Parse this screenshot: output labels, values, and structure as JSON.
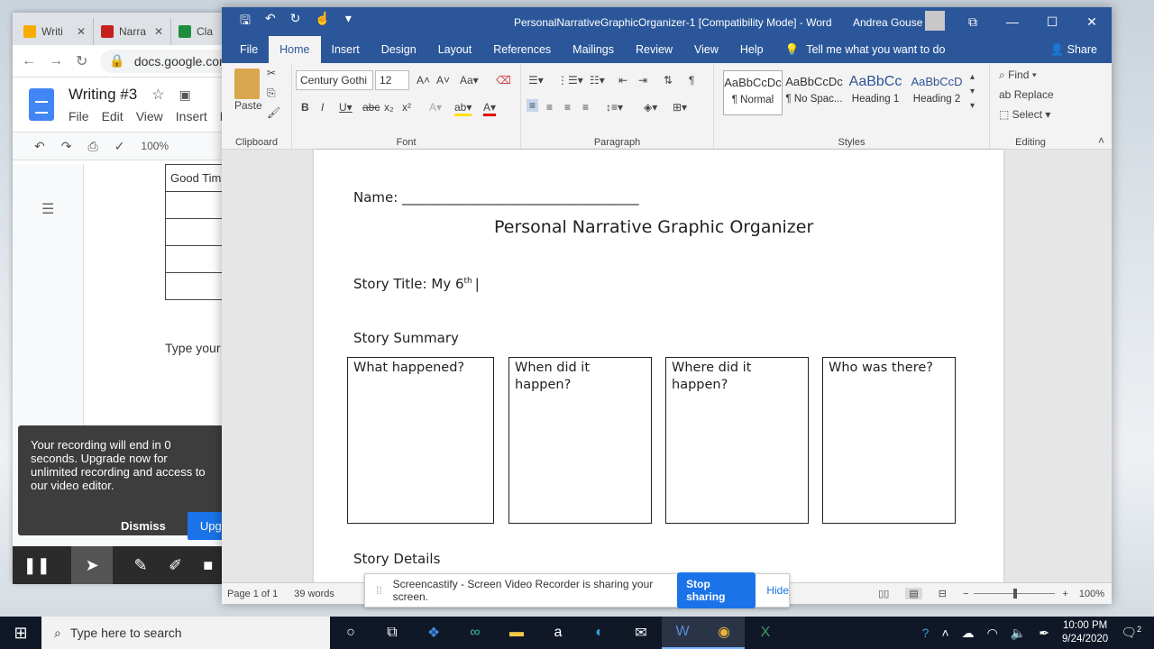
{
  "chrome": {
    "tabs": [
      {
        "label": "Writi",
        "color": "#f9ab00"
      },
      {
        "label": "Narra",
        "color": "#c5221f"
      },
      {
        "label": "Cla",
        "color": "#1e8e3e"
      }
    ],
    "url": "docs.google.com",
    "doc_title": "Writing #3",
    "menu": [
      "File",
      "Edit",
      "View",
      "Insert",
      "F"
    ],
    "zoom": "100%",
    "table_first_cell": "Good Tim",
    "body_text": "Type your"
  },
  "recording": {
    "message": "Your recording will end in 0 seconds. Upgrade now for unlimited recording and access to our video editor.",
    "dismiss": "Dismiss",
    "upgrade": "Upgr"
  },
  "word": {
    "title": "PersonalNarrativeGraphicOrganizer-1  [Compatibility Mode]  -  Word",
    "user": "Andrea Gouse",
    "tabs": [
      "File",
      "Home",
      "Insert",
      "Design",
      "Layout",
      "References",
      "Mailings",
      "Review",
      "View",
      "Help"
    ],
    "active_tab": "Home",
    "tell_me": "Tell me what you want to do",
    "share": "Share",
    "ribbon": {
      "paste": "Paste",
      "font_name": "Century Gothi",
      "font_size": "12",
      "styles": [
        {
          "preview": "AaBbCcDc",
          "name": "¶ Normal"
        },
        {
          "preview": "AaBbCcDc",
          "name": "¶ No Spac..."
        },
        {
          "preview": "AaBbCс",
          "name": "Heading 1"
        },
        {
          "preview": "AaBbCcD",
          "name": "Heading 2"
        }
      ],
      "find": "Find",
      "replace": "Replace",
      "select": "Select",
      "groups": {
        "clipboard": "Clipboard",
        "font": "Font",
        "paragraph": "Paragraph",
        "styles": "Styles",
        "editing": "Editing"
      }
    },
    "document": {
      "name_label": "Name: ___________________________________",
      "heading": "Personal Narrative Graphic Organizer",
      "story_title_label": "Story Title: ",
      "story_title_value": "My 6",
      "story_title_sup": "th",
      "summary_label": "Story Summary",
      "boxes": [
        "What happened?",
        "When did it happen?",
        "Where did it happen?",
        "Who was there?"
      ],
      "details_label": "Story Details"
    },
    "status": {
      "page": "Page 1 of 1",
      "words": "39 words",
      "zoom": "100%"
    }
  },
  "share_bar": {
    "message": "Screencastify - Screen Video Recorder is sharing your screen.",
    "stop": "Stop sharing",
    "hide": "Hide"
  },
  "taskbar": {
    "search_placeholder": "Type here to search",
    "time": "10:00 PM",
    "date": "9/24/2020",
    "notifications": "2"
  }
}
